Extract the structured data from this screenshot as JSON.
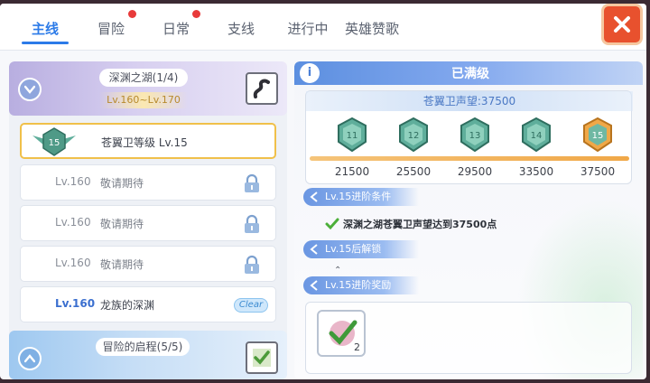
{
  "tabs": [
    {
      "label": "主线",
      "active": true,
      "badge": false
    },
    {
      "label": "冒险",
      "active": false,
      "badge": true
    },
    {
      "label": "日常",
      "active": false,
      "badge": true
    },
    {
      "label": "支线",
      "active": false,
      "badge": false
    },
    {
      "label": "进行中",
      "active": false,
      "badge": false
    },
    {
      "label": "英雄赞歌",
      "active": false,
      "badge": false
    }
  ],
  "left": {
    "chapter1": {
      "title": "深渊之湖(1/4)",
      "range": "Lv.160~Lv.170"
    },
    "rows": [
      {
        "lv": "15",
        "name": "苍翼卫等级 Lv.15",
        "state": "selected"
      },
      {
        "lv": "Lv.160",
        "name": "敬请期待",
        "state": "locked"
      },
      {
        "lv": "Lv.160",
        "name": "敬请期待",
        "state": "locked"
      },
      {
        "lv": "Lv.160",
        "name": "敬请期待",
        "state": "locked"
      },
      {
        "lv": "Lv.160",
        "name": "龙族的深渊",
        "state": "clear",
        "badge": "Clear"
      }
    ],
    "chapter2": {
      "title": "冒险的启程(5/5)"
    }
  },
  "right": {
    "header_title": "已满级",
    "track_title": "苍翼卫声望:37500",
    "levels": [
      {
        "level": "11",
        "value": "21500"
      },
      {
        "level": "12",
        "value": "25500"
      },
      {
        "level": "13",
        "value": "29500"
      },
      {
        "level": "14",
        "value": "33500"
      },
      {
        "level": "15",
        "value": "37500"
      }
    ],
    "sec_condition": "Lv.15进阶条件",
    "condition_text": "深渊之湖苍翼卫声望达到37500点",
    "sec_unlock": "Lv.15后解锁",
    "sec_reward": "Lv.15进阶奖励",
    "reward_count": "2"
  },
  "colors": {
    "accent": "#2c7be8",
    "close": "#e8512e",
    "progress": "#f0a848",
    "emblem_active": "#f0a848",
    "emblem": "#5fae9b"
  }
}
